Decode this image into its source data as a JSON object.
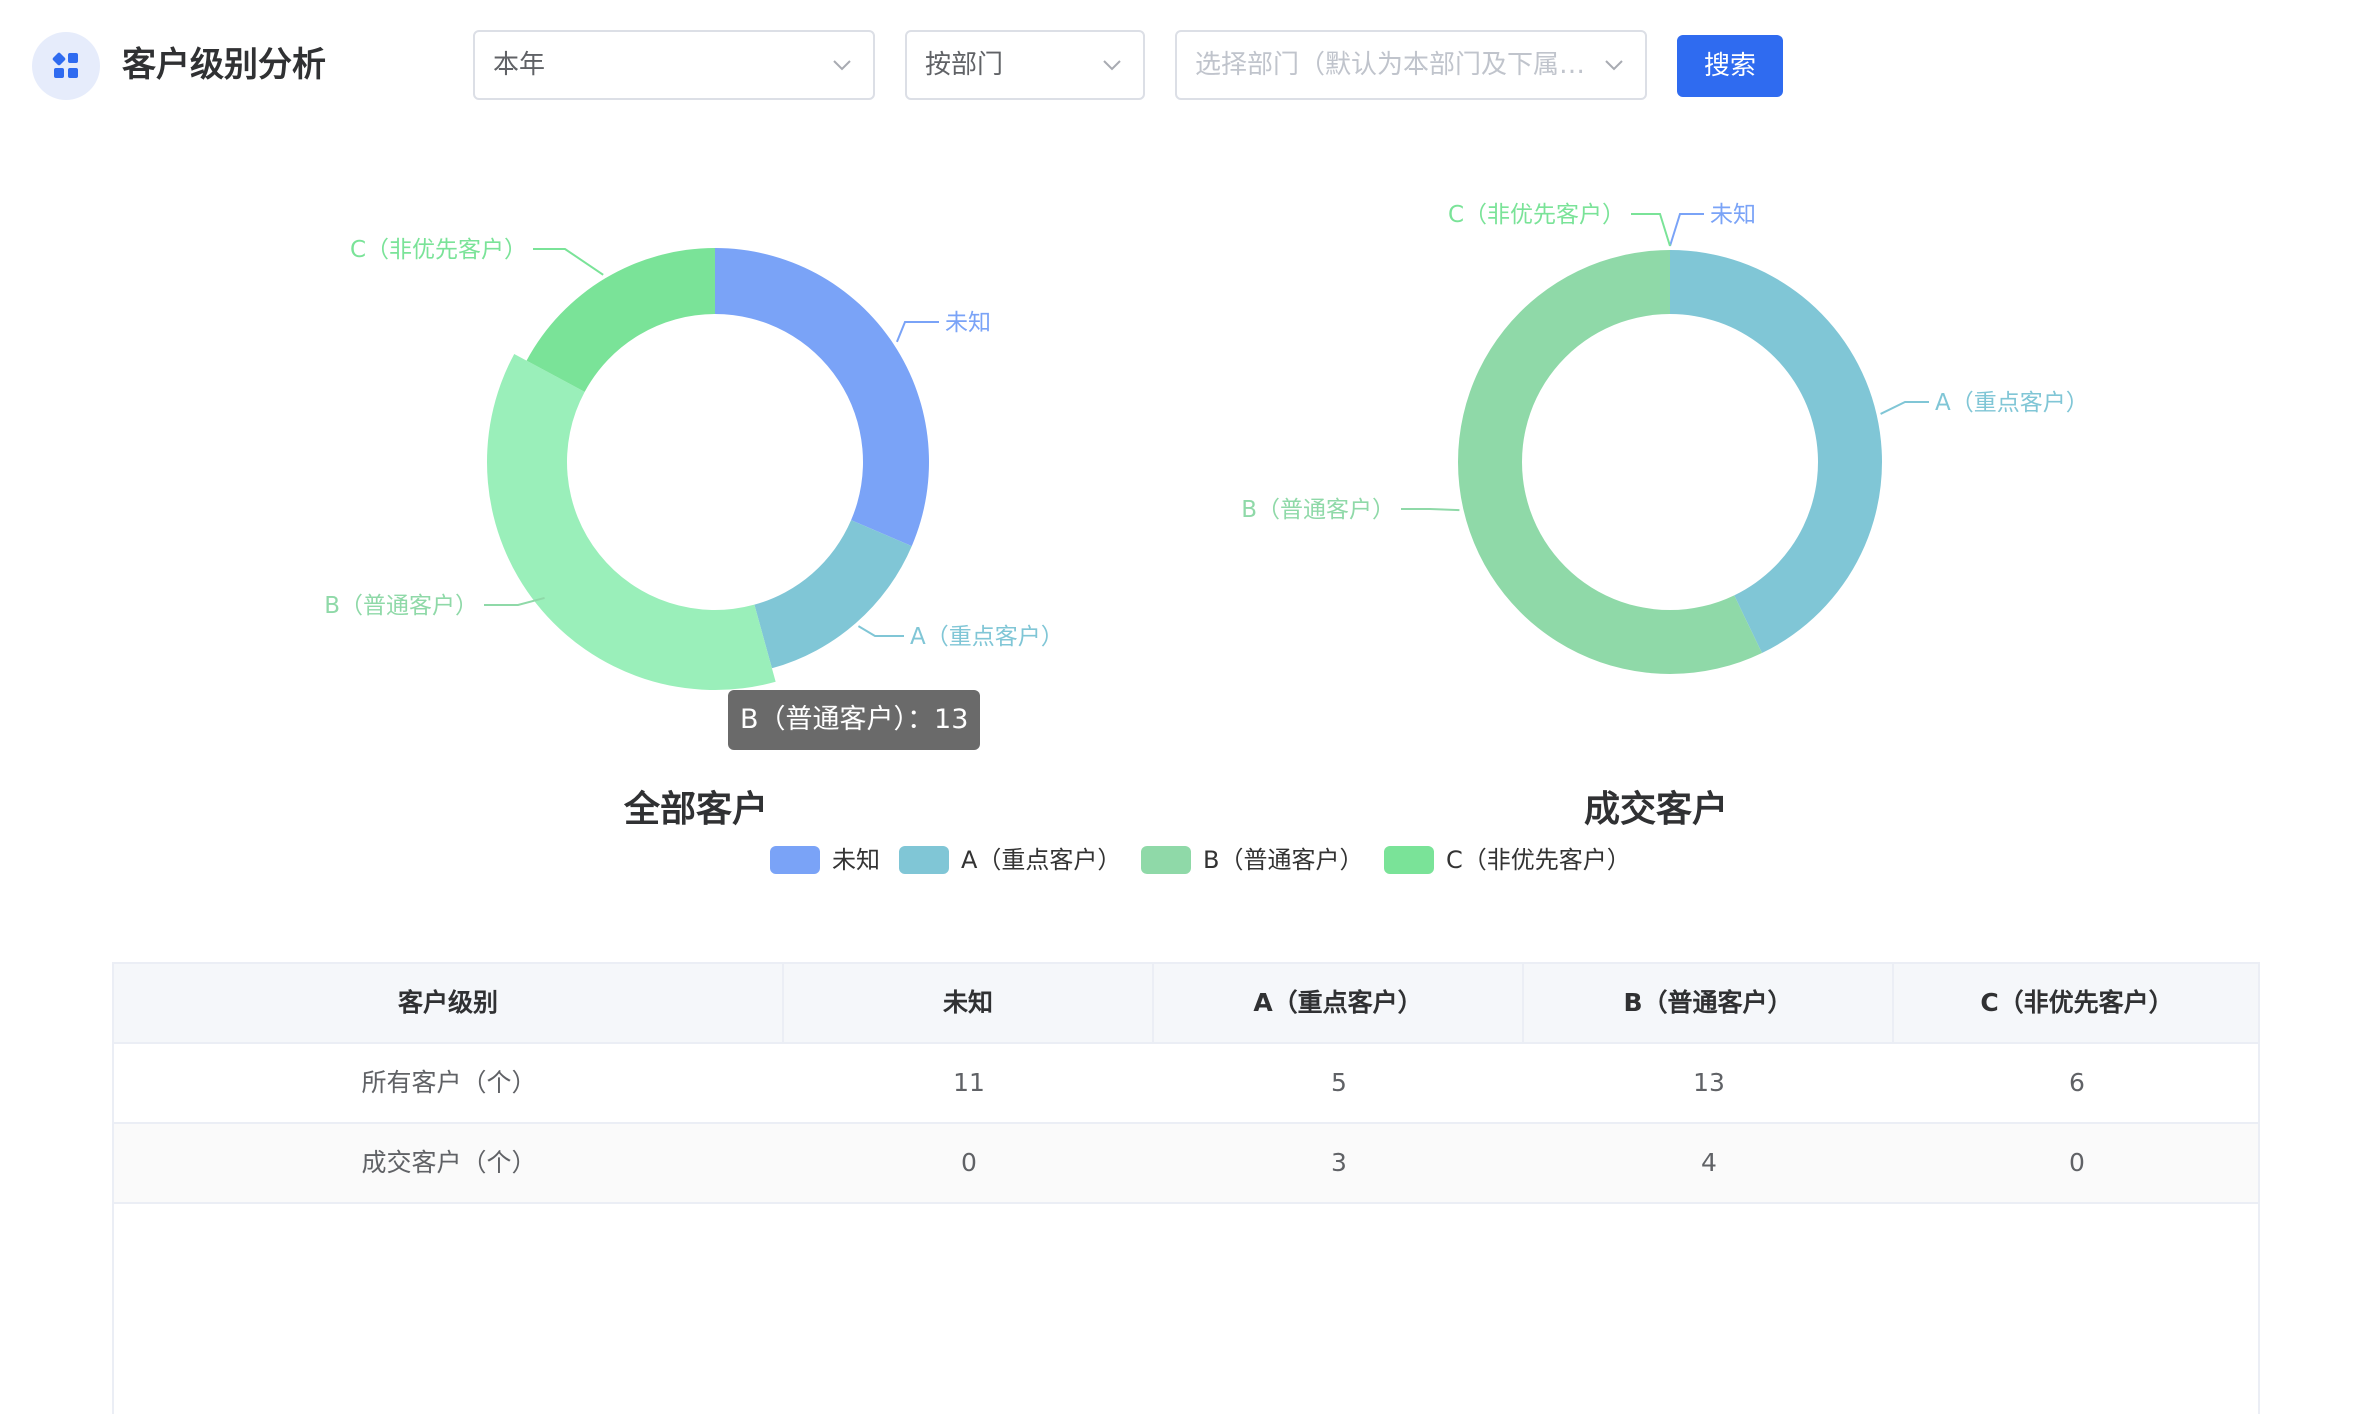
{
  "header": {
    "title": "客户级别分析",
    "icon": "dashboard-icon"
  },
  "filters": {
    "period": "本年",
    "dimension": "按部门",
    "department_placeholder": "选择部门（默认为本部门及下属部...",
    "search_label": "搜索"
  },
  "colors": {
    "unknown": "#7aa3f7",
    "a": "#80c6d6",
    "b": "#8fd9a8",
    "c": "#7ae398",
    "accent": "#2f6bf0"
  },
  "charts": {
    "all_title": "全部客户",
    "deal_title": "成交客户",
    "tooltip": "B（普通客户）：13"
  },
  "legend": [
    "未知",
    "A（重点客户）",
    "B（普通客户）",
    "C（非优先客户）"
  ],
  "chart_data": [
    {
      "type": "pie",
      "title": "全部客户",
      "categories": [
        "未知",
        "A（重点客户）",
        "B（普通客户）",
        "C（非优先客户）"
      ],
      "values": [
        11,
        5,
        13,
        6
      ],
      "highlighted": "B（普通客户）"
    },
    {
      "type": "pie",
      "title": "成交客户",
      "categories": [
        "未知",
        "A（重点客户）",
        "B（普通客户）",
        "C（非优先客户）"
      ],
      "values": [
        0,
        3,
        4,
        0
      ]
    }
  ],
  "table": {
    "headers": [
      "客户级别",
      "未知",
      "A（重点客户）",
      "B（普通客户）",
      "C（非优先客户）"
    ],
    "rows": [
      {
        "label": "所有客户（个）",
        "values": [
          "11",
          "5",
          "13",
          "6"
        ]
      },
      {
        "label": "成交客户（个）",
        "values": [
          "0",
          "3",
          "4",
          "0"
        ]
      }
    ]
  }
}
